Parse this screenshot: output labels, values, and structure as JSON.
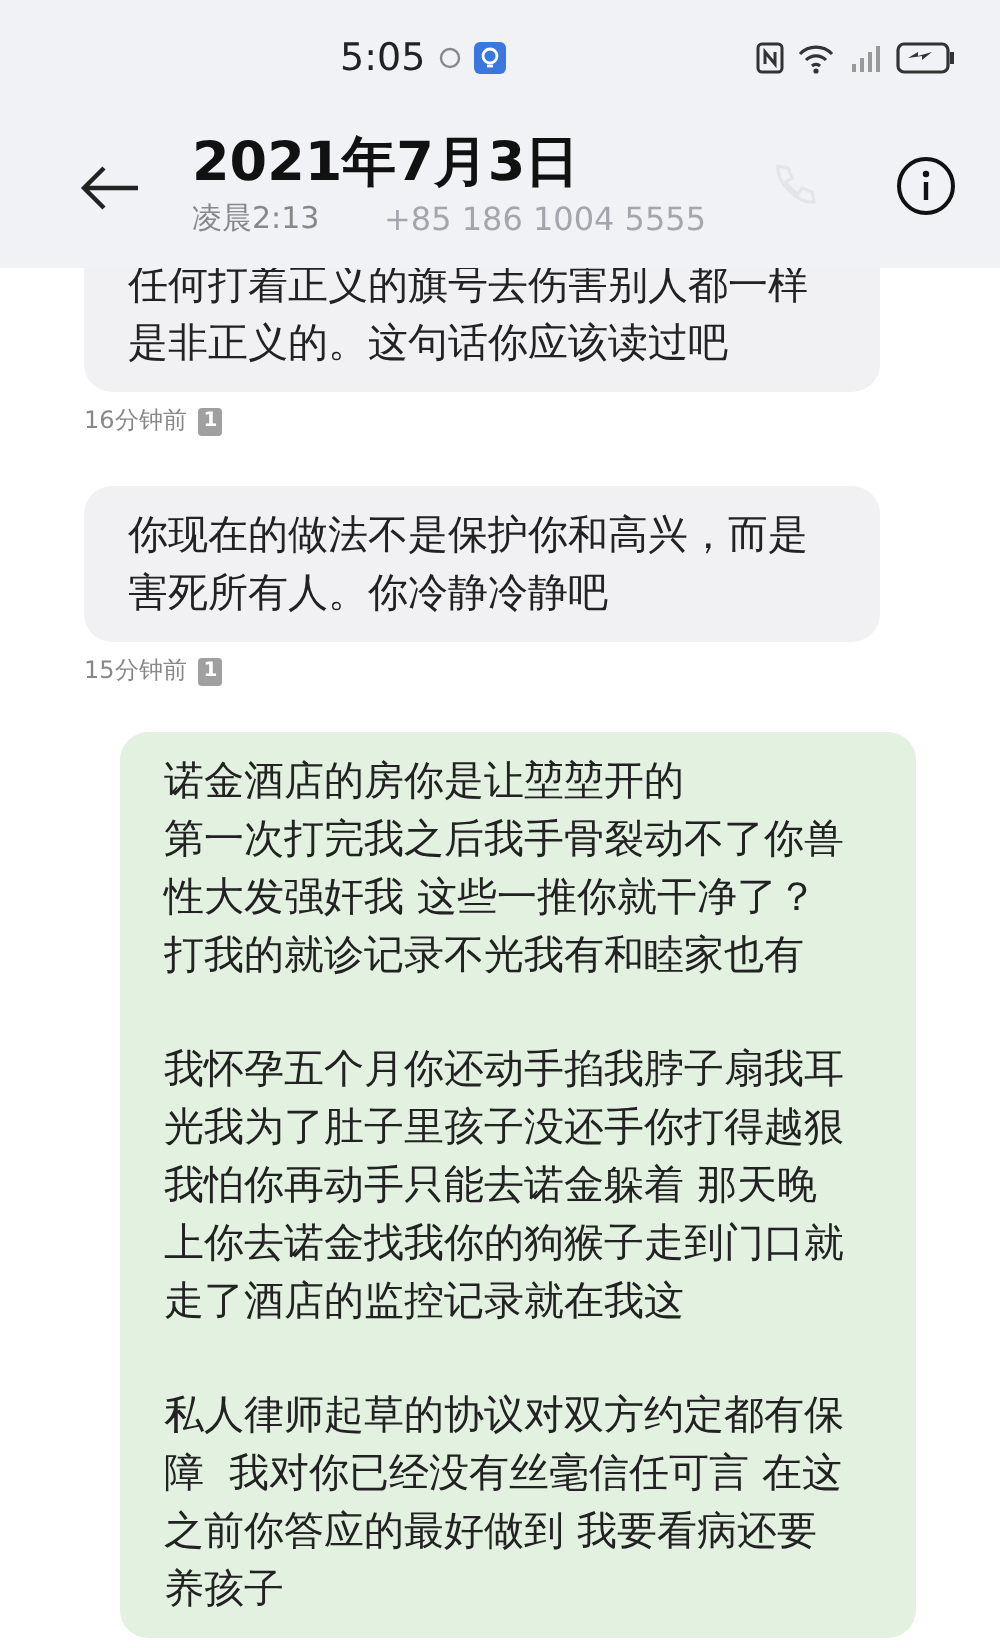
{
  "status_bar": {
    "time": "5:05"
  },
  "header": {
    "title": "2021年7月3日",
    "subtitle": "凌晨2:13",
    "faded_number": "+85 186 1004 5555"
  },
  "messages": [
    {
      "kind": "received",
      "paragraphs": [
        [
          "任何打着正义的旗号去伤害别人都一样是非正义的。这句话你应该读过吧"
        ]
      ],
      "time": "16分钟前",
      "sim": "1"
    },
    {
      "kind": "received",
      "paragraphs": [
        [
          "你现在的做法不是保护你和高兴，而是害死所有人。你冷静冷静吧"
        ]
      ],
      "time": "15分钟前",
      "sim": "1"
    },
    {
      "kind": "sent",
      "paragraphs": [
        [
          "诺金酒店的房你是让堃堃开的",
          "第一次打完我之后我手骨裂动不了你兽性大发强奸我 这些一推你就干净了？",
          "打我的就诊记录不光我有和睦家也有"
        ],
        [
          "我怀孕五个月你还动手掐我脖子扇我耳光我为了肚子里孩子没还手你打得越狠我怕你再动手只能去诺金躲着 那天晚上你去诺金找我你的狗猴子走到门口就走了酒店的监控记录就在我这"
        ],
        [
          "私人律师起草的协议对双方约定都有保障  我对你已经没有丝毫信任可言 在这之前你答应的最好做到 我要看病还要养孩子"
        ]
      ]
    }
  ]
}
